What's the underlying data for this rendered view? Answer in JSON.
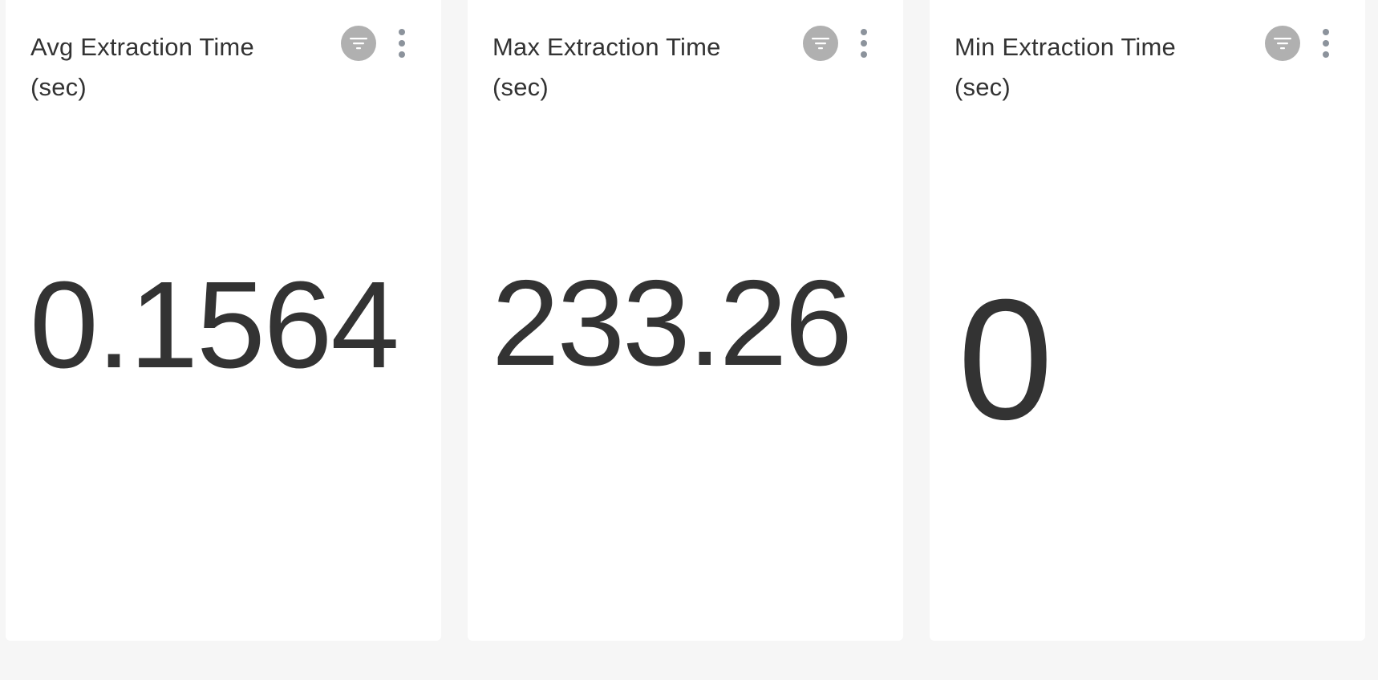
{
  "cards": [
    {
      "title": "Avg Extraction Time (sec)",
      "value": "0.1564",
      "filter_icon": "filter-icon",
      "menu_icon": "more-vertical-icon"
    },
    {
      "title": "Max Extraction Time (sec)",
      "value": "233.26",
      "filter_icon": "filter-icon",
      "menu_icon": "more-vertical-icon"
    },
    {
      "title": "Min Extraction Time (sec)",
      "value": "0",
      "filter_icon": "filter-icon",
      "menu_icon": "more-vertical-icon"
    }
  ],
  "colors": {
    "background": "#f6f6f6",
    "card": "#ffffff",
    "text": "#333333",
    "filter_button": "#b0b0b0",
    "menu_dots": "#8c939c"
  }
}
